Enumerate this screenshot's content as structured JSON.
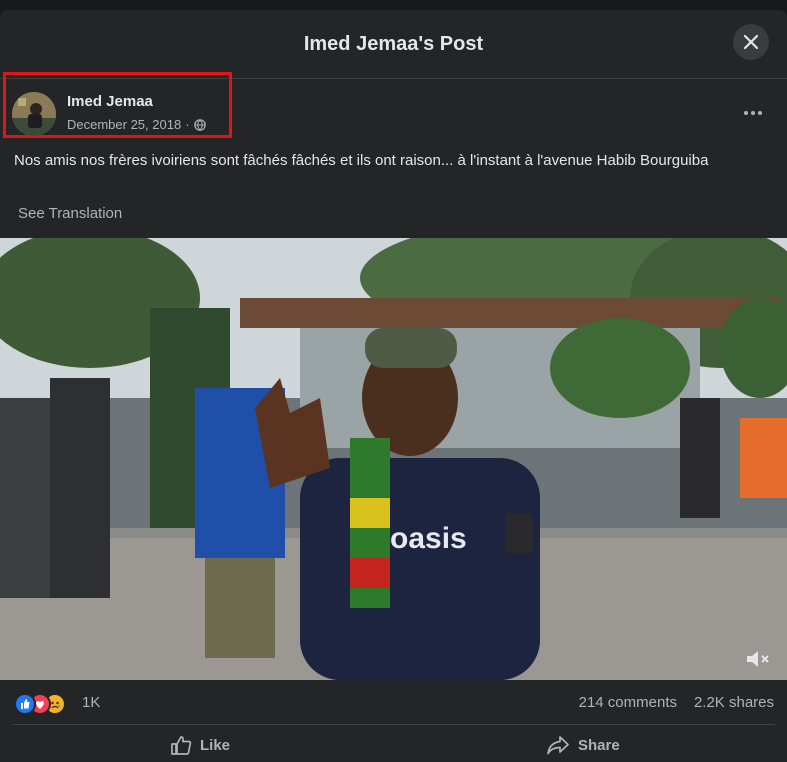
{
  "modal": {
    "title": "Imed Jemaa's Post"
  },
  "post": {
    "author": "Imed Jemaa",
    "date": "December 25, 2018",
    "meta_separator": "·",
    "text": "Nos amis nos frères ivoiriens sont fâchés fâchés et ils ont raison... à l'instant à l'avenue Habib Bourguiba",
    "see_translation": "See Translation",
    "video_shirt_text": "oasis"
  },
  "engagement": {
    "reactions": [
      "like",
      "love",
      "sad"
    ],
    "reaction_count": "1K",
    "comments": "214 comments",
    "shares": "2.2K shares"
  },
  "actions": {
    "like": "Like",
    "share": "Share"
  },
  "colors": {
    "background": "#242526",
    "highlight": "#e0151b",
    "like_blue": "#2078f4",
    "love_red": "#f33e58",
    "sad_yellow": "#f7b125"
  }
}
